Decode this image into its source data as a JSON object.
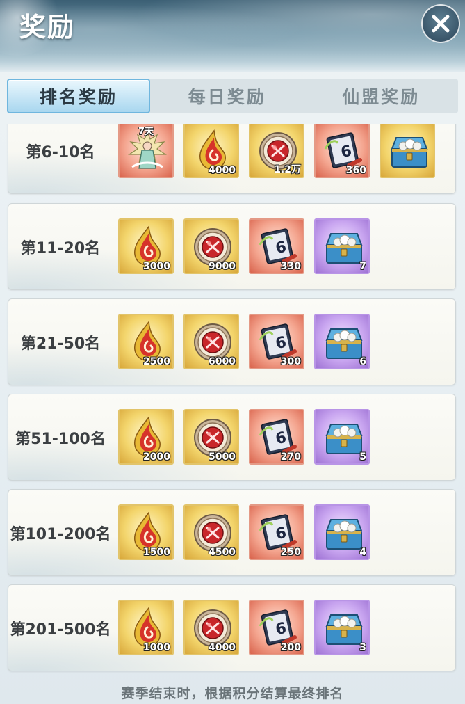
{
  "header": {
    "title": "奖励",
    "close_icon": "close-icon"
  },
  "tabs": [
    {
      "label": "排名奖励",
      "active": true
    },
    {
      "label": "每日奖励",
      "active": false
    },
    {
      "label": "仙盟奖励",
      "active": false
    }
  ],
  "rows": [
    {
      "label": "第6-10名",
      "items": [
        {
          "icon": "character-skin-icon",
          "quality": "red",
          "tag": "7天",
          "qty": ""
        },
        {
          "icon": "flame-drop-icon",
          "quality": "gold",
          "qty": "4000"
        },
        {
          "icon": "red-orb-medal-icon",
          "quality": "gold",
          "qty": "1.2万"
        },
        {
          "icon": "scroll-book-icon",
          "quality": "red",
          "qty": "360"
        },
        {
          "icon": "treasure-chest-icon",
          "quality": "gold",
          "qty": ""
        }
      ]
    },
    {
      "label": "第11-20名",
      "items": [
        {
          "icon": "flame-drop-icon",
          "quality": "gold",
          "qty": "3000"
        },
        {
          "icon": "red-orb-medal-icon",
          "quality": "gold",
          "qty": "9000"
        },
        {
          "icon": "scroll-book-icon",
          "quality": "red",
          "qty": "330"
        },
        {
          "icon": "treasure-chest-icon",
          "quality": "purple",
          "qty": "7"
        }
      ]
    },
    {
      "label": "第21-50名",
      "items": [
        {
          "icon": "flame-drop-icon",
          "quality": "gold",
          "qty": "2500"
        },
        {
          "icon": "red-orb-medal-icon",
          "quality": "gold",
          "qty": "6000"
        },
        {
          "icon": "scroll-book-icon",
          "quality": "red",
          "qty": "300"
        },
        {
          "icon": "treasure-chest-icon",
          "quality": "purple",
          "qty": "6"
        }
      ]
    },
    {
      "label": "第51-100名",
      "items": [
        {
          "icon": "flame-drop-icon",
          "quality": "gold",
          "qty": "2000"
        },
        {
          "icon": "red-orb-medal-icon",
          "quality": "gold",
          "qty": "5000"
        },
        {
          "icon": "scroll-book-icon",
          "quality": "red",
          "qty": "270"
        },
        {
          "icon": "treasure-chest-icon",
          "quality": "purple",
          "qty": "5"
        }
      ]
    },
    {
      "label": "第101-200名",
      "items": [
        {
          "icon": "flame-drop-icon",
          "quality": "gold",
          "qty": "1500"
        },
        {
          "icon": "red-orb-medal-icon",
          "quality": "gold",
          "qty": "4500"
        },
        {
          "icon": "scroll-book-icon",
          "quality": "red",
          "qty": "250"
        },
        {
          "icon": "treasure-chest-icon",
          "quality": "purple",
          "qty": "4"
        }
      ]
    },
    {
      "label": "第201-500名",
      "items": [
        {
          "icon": "flame-drop-icon",
          "quality": "gold",
          "qty": "1000"
        },
        {
          "icon": "red-orb-medal-icon",
          "quality": "gold",
          "qty": "4000"
        },
        {
          "icon": "scroll-book-icon",
          "quality": "red",
          "qty": "200"
        },
        {
          "icon": "treasure-chest-icon",
          "quality": "purple",
          "qty": "3"
        }
      ]
    }
  ],
  "footer_note": "赛季结束时，根据积分结算最终排名"
}
